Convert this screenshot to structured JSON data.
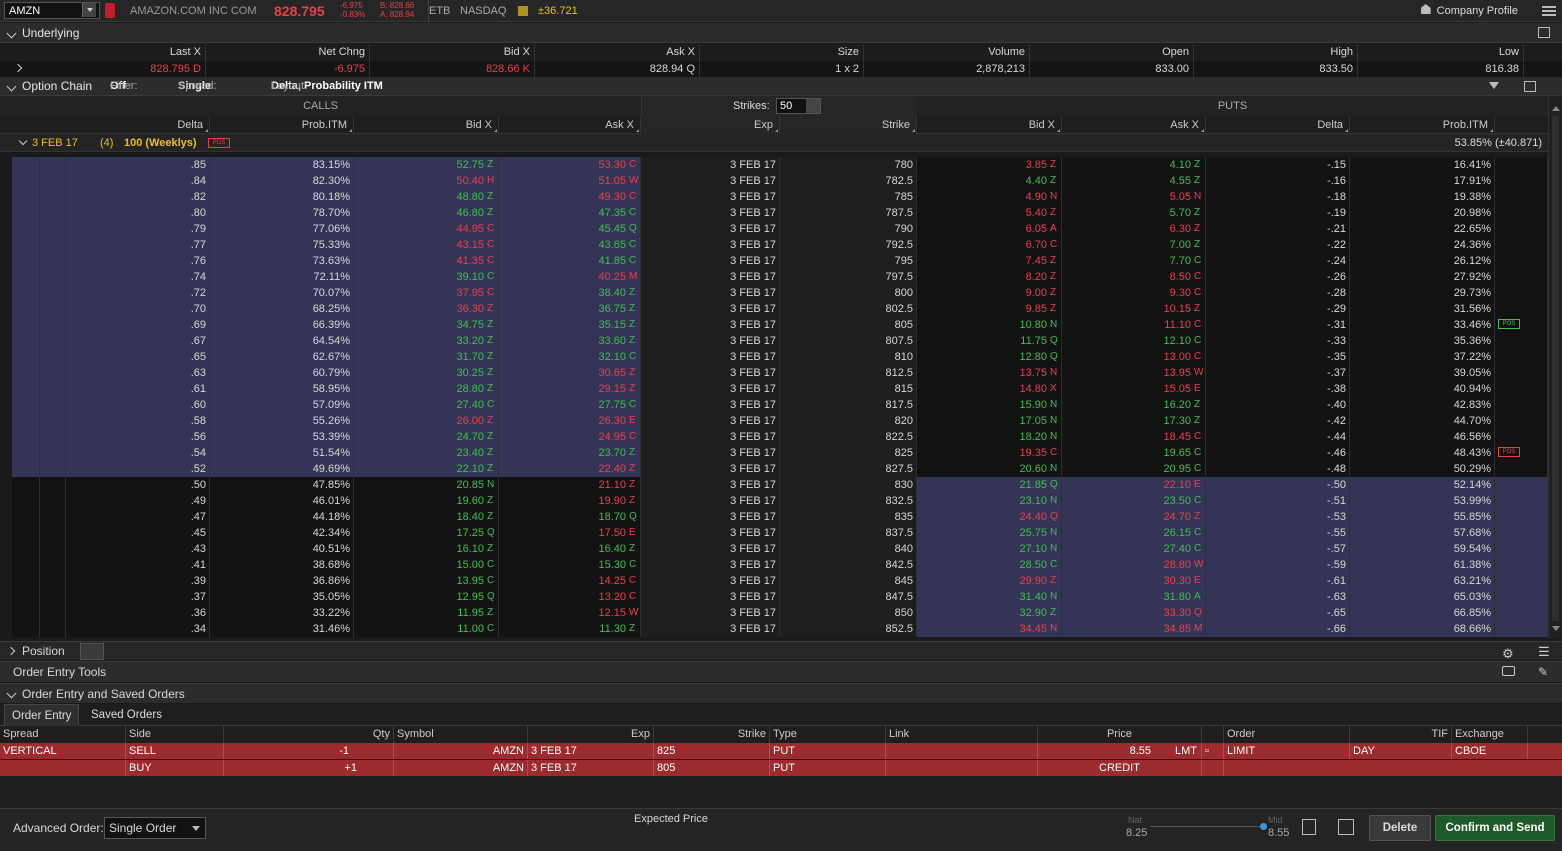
{
  "topbar": {
    "symbol": "AMZN",
    "company": "AMAZON.COM INC COM",
    "last": "828.795",
    "net_change": "-6.975",
    "pct_change": "-0.83%",
    "bid": "B: 828.66",
    "ask": "A: 828.94",
    "etb": "ETB",
    "exchange": "NASDAQ",
    "move": "±36.721",
    "company_profile": "Company Profile"
  },
  "underlying": {
    "title": "Underlying",
    "headers": [
      "Last X",
      "Net Chng",
      "Bid X",
      "Ask X",
      "Size",
      "Volume",
      "Open",
      "High",
      "Low"
    ],
    "last": "828.795",
    "last_ex": "D",
    "net_chng": "-6.975",
    "bid": "828.66",
    "bid_ex": "K",
    "ask": "828.94",
    "ask_ex": "Q",
    "size": "1 x 2",
    "volume": "2,878,213",
    "open": "833.00",
    "high": "833.50",
    "low": "816.38"
  },
  "option_chain": {
    "title": "Option Chain",
    "filter_label": "Filter:",
    "filter_value": "Off",
    "spread_label": "Spread:",
    "spread_value": "Single",
    "layout_label": "Layout:",
    "layout_value": "Delta, Probability ITM",
    "calls": "CALLS",
    "puts": "PUTS",
    "strikes_label": "Strikes:",
    "strikes_value": "50",
    "columns": {
      "delta": "Delta",
      "prob": "Prob.ITM",
      "bid": "Bid X",
      "ask": "Ask X",
      "exp": "Exp",
      "strike": "Strike",
      "pbid": "Bid X",
      "pask": "Ask X",
      "pdelta": "Delta",
      "pprob": "Prob.ITM"
    },
    "expiry_row": {
      "label": "3 FEB 17",
      "days": "(4)",
      "desc": "100 (Weeklys)",
      "right": "53.85% (±40.871)",
      "badge": "POS"
    },
    "rows": [
      [
        ".85",
        "83.15%",
        "52.75",
        "Z",
        "53.30",
        "C",
        "3 FEB 17",
        "780",
        "3.85",
        "Z",
        "4.10",
        "Z",
        "-.15",
        "16.41%"
      ],
      [
        ".84",
        "82.30%",
        "50.40",
        "H",
        "51.05",
        "W",
        "3 FEB 17",
        "782.5",
        "4.40",
        "Z",
        "4.55",
        "Z",
        "-.16",
        "17.91%"
      ],
      [
        ".82",
        "80.18%",
        "48.80",
        "Z",
        "49.30",
        "C",
        "3 FEB 17",
        "785",
        "4.90",
        "N",
        "5.05",
        "N",
        "-.18",
        "19.38%"
      ],
      [
        ".80",
        "78.70%",
        "46.80",
        "Z",
        "47.35",
        "C",
        "3 FEB 17",
        "787.5",
        "5.40",
        "Z",
        "5.70",
        "Z",
        "-.19",
        "20.98%"
      ],
      [
        ".79",
        "77.06%",
        "44.95",
        "C",
        "45.45",
        "Q",
        "3 FEB 17",
        "790",
        "6.05",
        "A",
        "6.30",
        "Z",
        "-.21",
        "22.65%"
      ],
      [
        ".77",
        "75.33%",
        "43.15",
        "C",
        "43.65",
        "C",
        "3 FEB 17",
        "792.5",
        "6.70",
        "C",
        "7.00",
        "Z",
        "-.22",
        "24.36%"
      ],
      [
        ".76",
        "73.63%",
        "41.35",
        "C",
        "41.85",
        "C",
        "3 FEB 17",
        "795",
        "7.45",
        "Z",
        "7.70",
        "C",
        "-.24",
        "26.12%"
      ],
      [
        ".74",
        "72.11%",
        "39.10",
        "C",
        "40.25",
        "M",
        "3 FEB 17",
        "797.5",
        "8.20",
        "Z",
        "8.50",
        "C",
        "-.26",
        "27.92%"
      ],
      [
        ".72",
        "70.07%",
        "37.95",
        "C",
        "38.40",
        "Z",
        "3 FEB 17",
        "800",
        "9.00",
        "Z",
        "9.30",
        "C",
        "-.28",
        "29.73%"
      ],
      [
        ".70",
        "68.25%",
        "36.30",
        "Z",
        "36.75",
        "Z",
        "3 FEB 17",
        "802.5",
        "9.85",
        "Z",
        "10.15",
        "Z",
        "-.29",
        "31.56%"
      ],
      [
        ".69",
        "66.39%",
        "34.75",
        "Z",
        "35.15",
        "Z",
        "3 FEB 17",
        "805",
        "10.80",
        "N",
        "11.10",
        "C",
        "-.31",
        "33.46%"
      ],
      [
        ".67",
        "64.54%",
        "33.20",
        "Z",
        "33.60",
        "Z",
        "3 FEB 17",
        "807.5",
        "11.75",
        "Q",
        "12.10",
        "C",
        "-.33",
        "35.36%"
      ],
      [
        ".65",
        "62.67%",
        "31.70",
        "Z",
        "32.10",
        "C",
        "3 FEB 17",
        "810",
        "12.80",
        "Q",
        "13.00",
        "C",
        "-.35",
        "37.22%"
      ],
      [
        ".63",
        "60.79%",
        "30.25",
        "Z",
        "30.65",
        "Z",
        "3 FEB 17",
        "812.5",
        "13.75",
        "N",
        "13.95",
        "W",
        "-.37",
        "39.05%"
      ],
      [
        ".61",
        "58.95%",
        "28.80",
        "Z",
        "29.15",
        "Z",
        "3 FEB 17",
        "815",
        "14.80",
        "X",
        "15.05",
        "E",
        "-.38",
        "40.94%"
      ],
      [
        ".60",
        "57.09%",
        "27.40",
        "C",
        "27.75",
        "C",
        "3 FEB 17",
        "817.5",
        "15.90",
        "N",
        "16.20",
        "Z",
        "-.40",
        "42.83%"
      ],
      [
        ".58",
        "55.26%",
        "26.00",
        "Z",
        "26.30",
        "E",
        "3 FEB 17",
        "820",
        "17.05",
        "N",
        "17.30",
        "Z",
        "-.42",
        "44.70%"
      ],
      [
        ".56",
        "53.39%",
        "24.70",
        "Z",
        "24.95",
        "C",
        "3 FEB 17",
        "822.5",
        "18.20",
        "N",
        "18.45",
        "C",
        "-.44",
        "46.56%"
      ],
      [
        ".54",
        "51.54%",
        "23.40",
        "Z",
        "23.70",
        "Z",
        "3 FEB 17",
        "825",
        "19.35",
        "C",
        "19.65",
        "C",
        "-.46",
        "48.43%"
      ],
      [
        ".52",
        "49.69%",
        "22.10",
        "Z",
        "22.40",
        "Z",
        "3 FEB 17",
        "827.5",
        "20.60",
        "N",
        "20.95",
        "C",
        "-.48",
        "50.29%"
      ],
      [
        ".50",
        "47.85%",
        "20.85",
        "N",
        "21.10",
        "Z",
        "3 FEB 17",
        "830",
        "21.85",
        "Q",
        "22.10",
        "E",
        "-.50",
        "52.14%"
      ],
      [
        ".49",
        "46.01%",
        "19.60",
        "Z",
        "19.90",
        "Z",
        "3 FEB 17",
        "832.5",
        "23.10",
        "N",
        "23.50",
        "C",
        "-.51",
        "53.99%"
      ],
      [
        ".47",
        "44.18%",
        "18.40",
        "Z",
        "18.70",
        "Q",
        "3 FEB 17",
        "835",
        "24.40",
        "Q",
        "24.70",
        "Z",
        "-.53",
        "55.85%"
      ],
      [
        ".45",
        "42.34%",
        "17.25",
        "Q",
        "17.50",
        "E",
        "3 FEB 17",
        "837.5",
        "25.75",
        "N",
        "26.15",
        "C",
        "-.55",
        "57.68%"
      ],
      [
        ".43",
        "40.51%",
        "16.10",
        "Z",
        "16.40",
        "Z",
        "3 FEB 17",
        "840",
        "27.10",
        "N",
        "27.40",
        "C",
        "-.57",
        "59.54%"
      ],
      [
        ".41",
        "38.68%",
        "15.00",
        "C",
        "15.30",
        "C",
        "3 FEB 17",
        "842.5",
        "28.50",
        "C",
        "28.80",
        "W",
        "-.59",
        "61.38%"
      ],
      [
        ".39",
        "36.86%",
        "13.95",
        "C",
        "14.25",
        "C",
        "3 FEB 17",
        "845",
        "29.90",
        "Z",
        "30.30",
        "E",
        "-.61",
        "63.21%"
      ],
      [
        ".37",
        "35.05%",
        "12.95",
        "Q",
        "13.20",
        "C",
        "3 FEB 17",
        "847.5",
        "31.40",
        "N",
        "31.80",
        "A",
        "-.63",
        "65.03%"
      ],
      [
        ".36",
        "33.22%",
        "11.95",
        "Z",
        "12.15",
        "W",
        "3 FEB 17",
        "850",
        "32.90",
        "Z",
        "33.30",
        "Q",
        "-.65",
        "66.85%"
      ],
      [
        ".34",
        "31.46%",
        "11.00",
        "C",
        "11.30",
        "Z",
        "3 FEB 17",
        "852.5",
        "34.45",
        "N",
        "34.85",
        "M",
        "-.66",
        "68.66%"
      ]
    ],
    "colors": [
      [
        "g",
        "r",
        "r",
        "g",
        "r",
        "g"
      ],
      [
        "r",
        "r",
        "g",
        "g",
        "r",
        "g"
      ],
      [
        "g",
        "r",
        "r",
        "r",
        "r",
        "r"
      ],
      [
        "g",
        "g",
        "r",
        "g",
        "r",
        "g"
      ],
      [
        "r",
        "g",
        "r",
        "r",
        "r",
        "r"
      ],
      [
        "r",
        "g",
        "r",
        "g",
        "r",
        "g"
      ],
      [
        "r",
        "g",
        "r",
        "g",
        "r",
        "r"
      ],
      [
        "g",
        "r",
        "r",
        "r",
        "r",
        "r"
      ],
      [
        "r",
        "g",
        "r",
        "r",
        "r",
        "r"
      ],
      [
        "r",
        "g",
        "r",
        "r",
        "r",
        "r"
      ],
      [
        "g",
        "g",
        "g",
        "r",
        "g",
        "r"
      ],
      [
        "g",
        "g",
        "g",
        "g",
        "g",
        "r"
      ],
      [
        "g",
        "g",
        "g",
        "r",
        "g",
        "r"
      ],
      [
        "g",
        "r",
        "r",
        "r",
        "r",
        "r"
      ],
      [
        "g",
        "r",
        "r",
        "r",
        "r",
        "r"
      ],
      [
        "g",
        "g",
        "g",
        "g",
        "r",
        "r"
      ],
      [
        "r",
        "r",
        "g",
        "g",
        "r",
        "r"
      ],
      [
        "g",
        "r",
        "g",
        "r",
        "r",
        "r"
      ],
      [
        "g",
        "g",
        "r",
        "g",
        "r",
        "g"
      ],
      [
        "g",
        "r",
        "g",
        "g",
        "r",
        "r"
      ],
      [
        "g",
        "r",
        "g",
        "r",
        "r",
        "r"
      ],
      [
        "g",
        "r",
        "g",
        "g",
        "r",
        "g"
      ],
      [
        "g",
        "g",
        "r",
        "r",
        "r",
        "r"
      ],
      [
        "g",
        "r",
        "g",
        "g",
        "r",
        "g"
      ],
      [
        "g",
        "g",
        "g",
        "g",
        "r",
        "r"
      ],
      [
        "g",
        "g",
        "g",
        "r",
        "r",
        "r"
      ],
      [
        "g",
        "r",
        "r",
        "r",
        "r",
        "r"
      ],
      [
        "g",
        "r",
        "g",
        "g",
        "r",
        "r"
      ],
      [
        "g",
        "r",
        "g",
        "r",
        "r",
        "r"
      ],
      [
        "g",
        "g",
        "r",
        "r",
        "r",
        "r"
      ]
    ],
    "pos_put_rows": [
      10,
      18
    ]
  },
  "bottom": {
    "position": "Position",
    "order_entry_tools": "Order Entry Tools",
    "order_entry_saved": "Order Entry and Saved Orders",
    "tab_order_entry": "Order Entry",
    "tab_saved_orders": "Saved Orders",
    "headers": {
      "spread": "Spread",
      "side": "Side",
      "qty": "Qty",
      "symbol": "Symbol",
      "exp": "Exp",
      "strike": "Strike",
      "type": "Type",
      "link": "Link",
      "price": "Price",
      "order": "Order",
      "tif": "TIF",
      "exchange": "Exchange"
    },
    "leg1": {
      "spread": "VERTICAL",
      "side": "SELL",
      "qty": "-1",
      "symbol": "AMZN",
      "exp": "3 FEB 17",
      "strike": "825",
      "type": "PUT",
      "price": "8.55",
      "lmt": "LMT",
      "order": "LIMIT",
      "tif": "DAY",
      "exchange": "CBOE"
    },
    "leg2": {
      "side": "BUY",
      "qty": "+1",
      "symbol": "AMZN",
      "exp": "3 FEB 17",
      "strike": "805",
      "type": "PUT",
      "credit": "CREDIT"
    },
    "advanced_label": "Advanced Order:",
    "advanced_value": "Single Order",
    "expected_price": "Expected  Price",
    "nat_label": "Nat",
    "nat_value": "8.25",
    "mid_label": "Mid",
    "mid_value": "8.55",
    "delete": "Delete",
    "confirm": "Confirm and Send"
  }
}
